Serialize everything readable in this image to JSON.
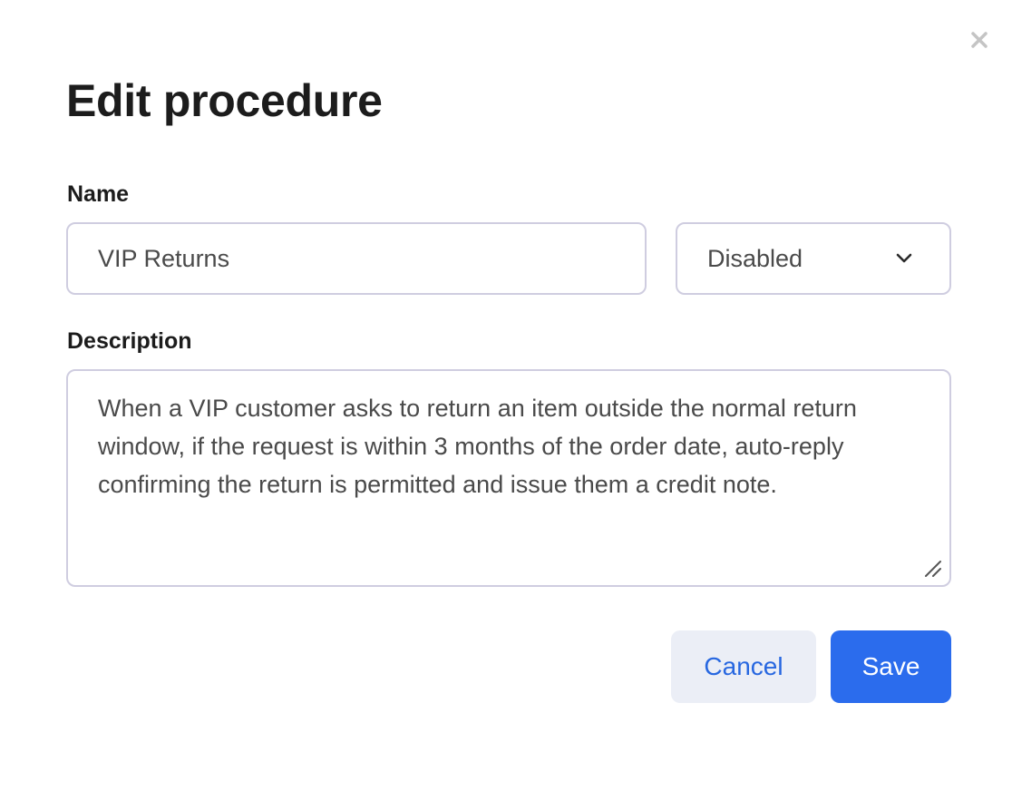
{
  "dialog": {
    "title": "Edit procedure",
    "close_icon": "close-icon"
  },
  "form": {
    "name_label": "Name",
    "name_value": "VIP Returns",
    "status_value": "Disabled",
    "status_icon": "chevron-down-icon",
    "description_label": "Description",
    "description_value": "When a VIP customer asks to return an item outside the normal return window, if the request is within 3 months of the order date, auto-reply confirming the return is permitted and issue them a credit note."
  },
  "actions": {
    "cancel_label": "Cancel",
    "save_label": "Save"
  },
  "colors": {
    "accent": "#2b6ced",
    "cancel_bg": "#ebeef6",
    "border": "#cfcde0"
  }
}
